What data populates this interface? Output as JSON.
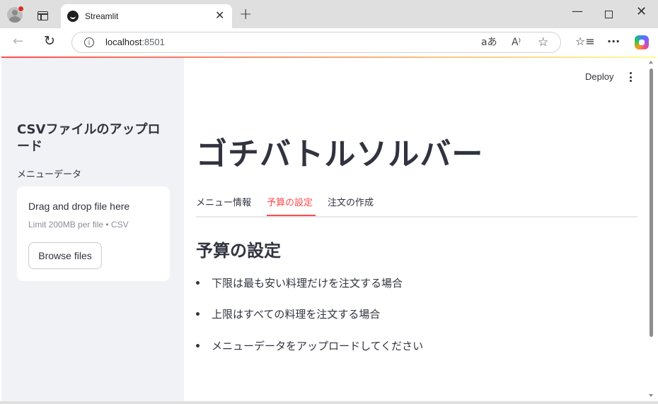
{
  "browser": {
    "tab_title": "Streamlit",
    "url_host": "localhost",
    "url_port": ":8501"
  },
  "app": {
    "deploy_label": "Deploy",
    "sidebar": {
      "title": "CSVファイルのアップロード",
      "uploader_label": "メニューデータ",
      "dropzone_text": "Drag and drop file here",
      "limit_text": "Limit 200MB per file • CSV",
      "browse_label": "Browse files"
    },
    "main": {
      "title": "ゴチバトルソルバー",
      "tabs": [
        {
          "label": "メニュー情報",
          "active": false
        },
        {
          "label": "予算の設定",
          "active": true
        },
        {
          "label": "注文の作成",
          "active": false
        }
      ],
      "section_heading": "予算の設定",
      "bullets": [
        "下限は最も安い料理だけを注文する場合",
        "上限はすべての料理を注文する場合",
        "メニューデータをアップロードしてください"
      ]
    },
    "accent_color": "#ff4b4b"
  }
}
